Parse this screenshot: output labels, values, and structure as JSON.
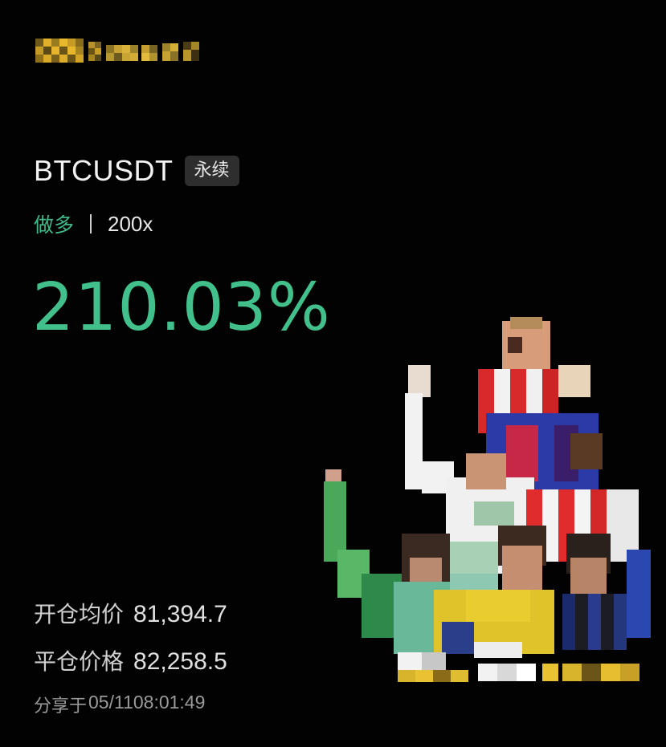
{
  "trade": {
    "symbol": "BTCUSDT",
    "contract_type": "永续",
    "side": "做多",
    "leverage": "200x",
    "pnl_percent": "210.03%"
  },
  "details": {
    "entry_label": "开仓均价",
    "entry_price": "81,394.7",
    "close_label": "平仓价格",
    "close_price": "82,258.5"
  },
  "footer": {
    "shared_label": "分享于",
    "timestamp": "05/1108:01:49"
  },
  "icons": {
    "logo": "brand-logo-pixelated",
    "artwork": "football-players-collage"
  },
  "colors": {
    "background": "#020202",
    "profit_green": "#42c08c",
    "side_green": "#3fb988",
    "tag_bg": "#2e2e2e",
    "logo_gold": "#d8a824"
  }
}
